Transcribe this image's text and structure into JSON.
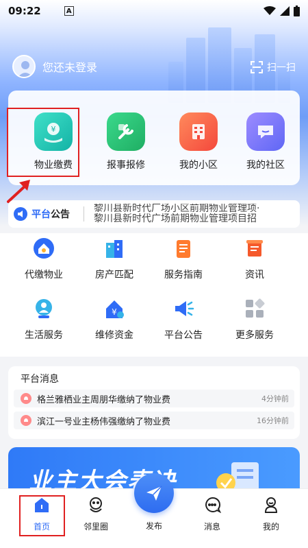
{
  "status_bar": {
    "time": "09:22",
    "badge": "A"
  },
  "header": {
    "login_text": "您还未登录",
    "scan_label": "扫一扫"
  },
  "quick_actions": [
    {
      "label": "物业缴费",
      "icon": "yuan-hand-icon",
      "color": "#19c4b0"
    },
    {
      "label": "报事报修",
      "icon": "wrench-icon",
      "color": "#2fc27a"
    },
    {
      "label": "我的小区",
      "icon": "building-icon",
      "color": "#ff6a4a"
    },
    {
      "label": "我的社区",
      "icon": "chat-icon",
      "color": "#7a6cff"
    }
  ],
  "announcement": {
    "title_part1": "平台",
    "title_part2": "公告",
    "line1": "黎川县新时代厂场小区前期物业管理项·",
    "line2": "黎川县新时代广场前期物业管理项目招"
  },
  "services": [
    {
      "label": "代缴物业",
      "icon": "house-pay-icon"
    },
    {
      "label": "房产匹配",
      "icon": "buildings-icon"
    },
    {
      "label": "服务指南",
      "icon": "guide-book-icon"
    },
    {
      "label": "资讯",
      "icon": "news-scroll-icon"
    },
    {
      "label": "生活服务",
      "icon": "person-service-icon"
    },
    {
      "label": "维修资金",
      "icon": "house-yuan-icon"
    },
    {
      "label": "平台公告",
      "icon": "megaphone-icon"
    },
    {
      "label": "更多服务",
      "icon": "more-grid-icon"
    }
  ],
  "messages": {
    "title": "平台消息",
    "items": [
      {
        "text": "格兰雅栖业主周朋华缴纳了物业费",
        "time": "4分钟前"
      },
      {
        "text": "滨江一号业主杨伟强缴纳了物业费",
        "time": "16分钟前"
      }
    ]
  },
  "banner": {
    "text": "业主大会表决"
  },
  "tabbar": {
    "items": [
      {
        "label": "首页",
        "icon": "home-icon"
      },
      {
        "label": "邻里圈",
        "icon": "neighborhood-icon"
      },
      {
        "label": "发布",
        "icon": "paper-plane-icon"
      },
      {
        "label": "消息",
        "icon": "message-icon"
      },
      {
        "label": "我的",
        "icon": "profile-icon"
      }
    ]
  },
  "colors": {
    "primary": "#2f6cf6",
    "highlight_box": "#e02020"
  }
}
